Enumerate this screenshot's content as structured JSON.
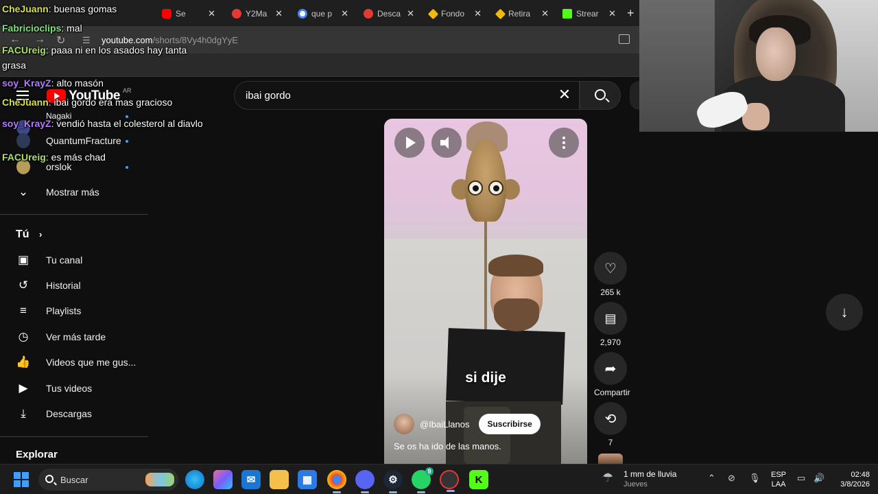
{
  "browser": {
    "tabs": [
      {
        "label": "Se",
        "color": "#ff0000"
      },
      {
        "label": "Y2Ma",
        "color": "#e53935"
      },
      {
        "label": "que p",
        "color": "#4285f4"
      },
      {
        "label": "Desca",
        "color": "#e53935"
      },
      {
        "label": "Fondo",
        "color": "#f0b90b"
      },
      {
        "label": "Retira",
        "color": "#f0b90b"
      },
      {
        "label": "Strear",
        "color": "#53fc18"
      }
    ],
    "url_host": "youtube.com",
    "url_path": "/shorts/8Vy4h0dgYyE"
  },
  "youtube": {
    "logo_text": "YouTube",
    "country_code": "AR",
    "search_query": "ibai gordo"
  },
  "sidebar": {
    "subscriptions": [
      {
        "label": "Nagaki"
      },
      {
        "label": "QuantumFracture"
      },
      {
        "label": "orslok"
      }
    ],
    "show_more": "Mostrar más",
    "you_heading": "Tú",
    "you_items": [
      {
        "label": "Tu canal",
        "icon": "channel-icon"
      },
      {
        "label": "Historial",
        "icon": "history-icon"
      },
      {
        "label": "Playlists",
        "icon": "playlists-icon"
      },
      {
        "label": "Ver más tarde",
        "icon": "watch-later-icon"
      },
      {
        "label": "Videos que me gus...",
        "icon": "liked-icon"
      },
      {
        "label": "Tus videos",
        "icon": "your-videos-icon"
      },
      {
        "label": "Descargas",
        "icon": "downloads-icon"
      }
    ],
    "explore_heading": "Explorar"
  },
  "short": {
    "subtitle": "si dije",
    "channel": "@IbaiLlanos",
    "subscribe": "Suscribirse",
    "description": "Se os ha ido de las manos.",
    "likes": "265 k",
    "comments": "2,970",
    "share": "Compartir",
    "remix": "7"
  },
  "chat": [
    {
      "user": "CheJuann",
      "color": "#d6e04a",
      "text": ": buenas gomas"
    },
    {
      "user": "Fabricioclips",
      "color": "#7fe07a",
      "text": ": mal"
    },
    {
      "user": "FACUreig",
      "color": "#a8e06a",
      "text": ": paaa ni en los asados hay tanta grasa"
    },
    {
      "user": "soy_KrayZ",
      "color": "#b57bff",
      "text": ": alto masón"
    },
    {
      "user": "CheJuann",
      "color": "#d6e04a",
      "text": ": ibai gordo era mas gracioso"
    },
    {
      "user": "soy_KrayZ",
      "color": "#b57bff",
      "text": ": vendió hasta el colesterol al diavlo"
    },
    {
      "user": "FACUreig",
      "color": "#a8e06a",
      "text": ": es más chad"
    }
  ],
  "taskbar": {
    "search_label": "Buscar",
    "weather_line1": "1 mm de lluvia",
    "weather_line2": "Jueves",
    "lang_line1": "ESP",
    "lang_line2": "LAA",
    "time": "02:48",
    "date": "3/8/2026",
    "whatsapp_badge": "9"
  }
}
